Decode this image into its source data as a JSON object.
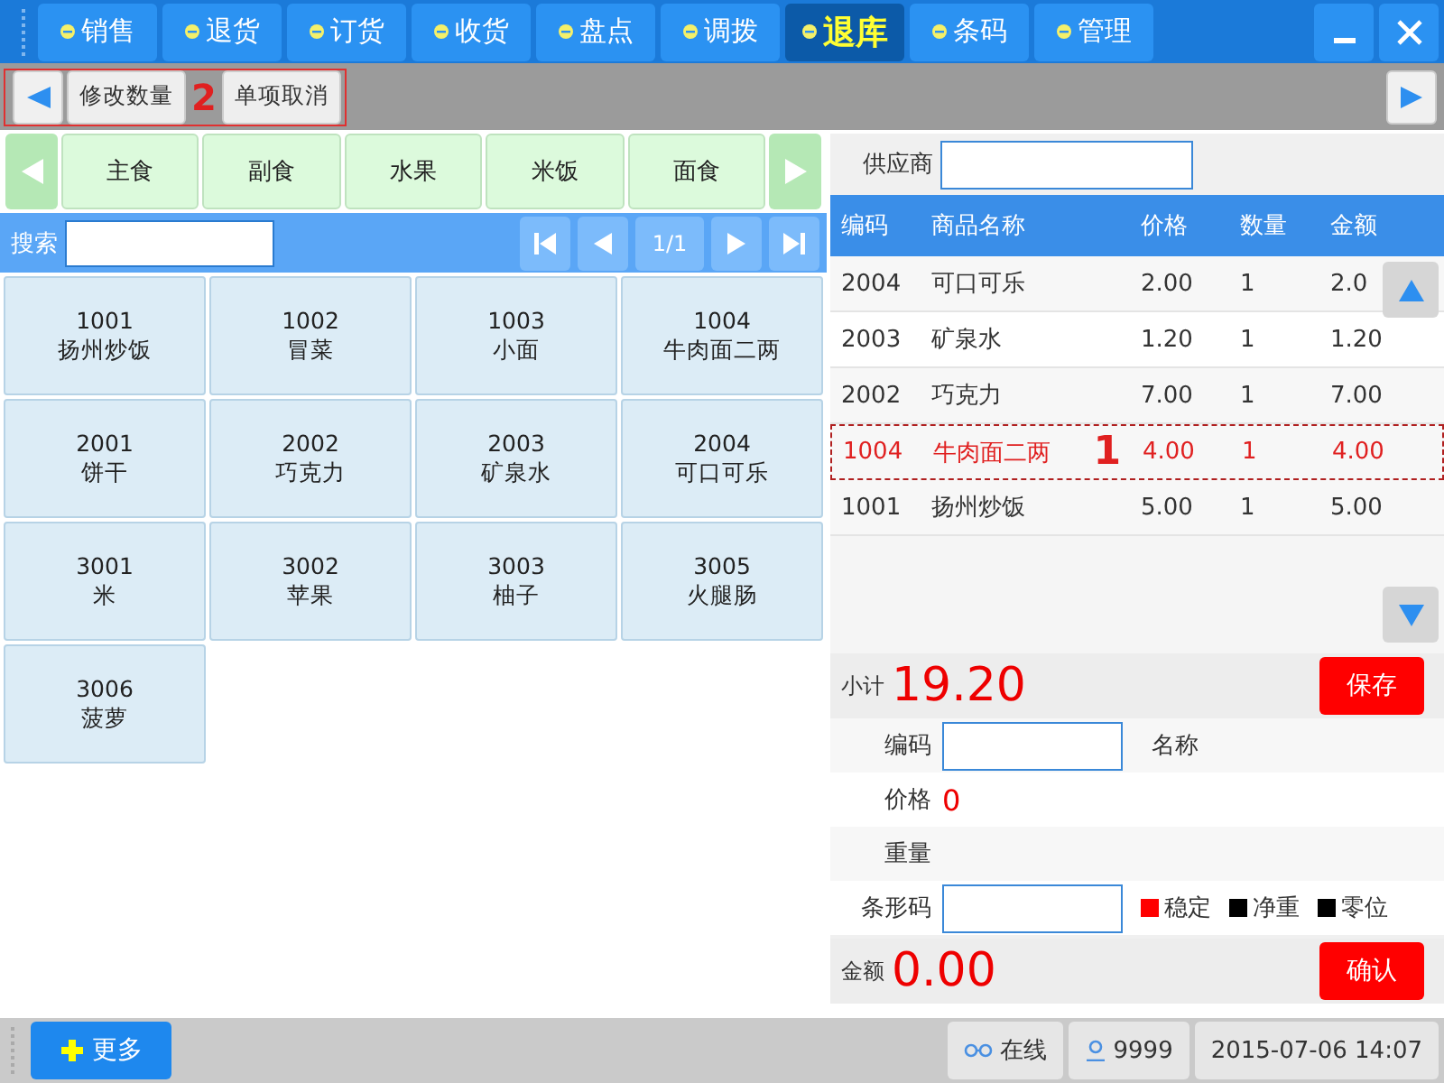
{
  "top_tabs": [
    {
      "label": "销售",
      "selected": false
    },
    {
      "label": "退货",
      "selected": false
    },
    {
      "label": "订货",
      "selected": false
    },
    {
      "label": "收货",
      "selected": false
    },
    {
      "label": "盘点",
      "selected": false
    },
    {
      "label": "调拨",
      "selected": false
    },
    {
      "label": "退库",
      "selected": true
    },
    {
      "label": "条码",
      "selected": false
    },
    {
      "label": "管理",
      "selected": false
    }
  ],
  "toolbar": {
    "buttons": [
      "修改数量",
      "单项取消"
    ],
    "annotation": "2"
  },
  "categories": [
    "主食",
    "副食",
    "水果",
    "米饭",
    "面食"
  ],
  "search": {
    "label": "搜索",
    "page": "1/1"
  },
  "products": [
    {
      "code": "1001",
      "name": "扬州炒饭"
    },
    {
      "code": "1002",
      "name": "冒菜"
    },
    {
      "code": "1003",
      "name": "小面"
    },
    {
      "code": "1004",
      "name": "牛肉面二两"
    },
    {
      "code": "2001",
      "name": "饼干"
    },
    {
      "code": "2002",
      "name": "巧克力"
    },
    {
      "code": "2003",
      "name": "矿泉水"
    },
    {
      "code": "2004",
      "name": "可口可乐"
    },
    {
      "code": "3001",
      "name": "米"
    },
    {
      "code": "3002",
      "name": "苹果"
    },
    {
      "code": "3003",
      "name": "柚子"
    },
    {
      "code": "3005",
      "name": "火腿肠"
    },
    {
      "code": "3006",
      "name": "菠萝"
    }
  ],
  "supplier": {
    "label": "供应商"
  },
  "cart": {
    "columns": [
      "编码",
      "商品名称",
      "价格",
      "数量",
      "金额"
    ],
    "annotation": "1",
    "rows": [
      {
        "code": "2004",
        "name": "可口可乐",
        "price": "2.00",
        "qty": "1",
        "amount": "2.0",
        "selected": false
      },
      {
        "code": "2003",
        "name": "矿泉水",
        "price": "1.20",
        "qty": "1",
        "amount": "1.20",
        "selected": false
      },
      {
        "code": "2002",
        "name": "巧克力",
        "price": "7.00",
        "qty": "1",
        "amount": "7.00",
        "selected": false
      },
      {
        "code": "1004",
        "name": "牛肉面二两",
        "price": "4.00",
        "qty": "1",
        "amount": "4.00",
        "selected": true
      },
      {
        "code": "1001",
        "name": "扬州炒饭",
        "price": "5.00",
        "qty": "1",
        "amount": "5.00",
        "selected": false
      }
    ]
  },
  "subtotal": {
    "label": "小计",
    "value": "19.20",
    "button": "保存"
  },
  "form": {
    "code_label": "编码",
    "name_label": "名称",
    "price_label": "价格",
    "price_value": "0",
    "weight_label": "重量",
    "barcode_label": "条形码",
    "indicators": [
      {
        "label": "稳定",
        "on": true
      },
      {
        "label": "净重",
        "on": false
      },
      {
        "label": "零位",
        "on": false
      }
    ]
  },
  "total": {
    "label": "金额",
    "value": "0.00",
    "button": "确认"
  },
  "status_bar": {
    "more": "更多",
    "online": "在线",
    "user": "9999",
    "datetime": "2015-07-06 14:07"
  }
}
